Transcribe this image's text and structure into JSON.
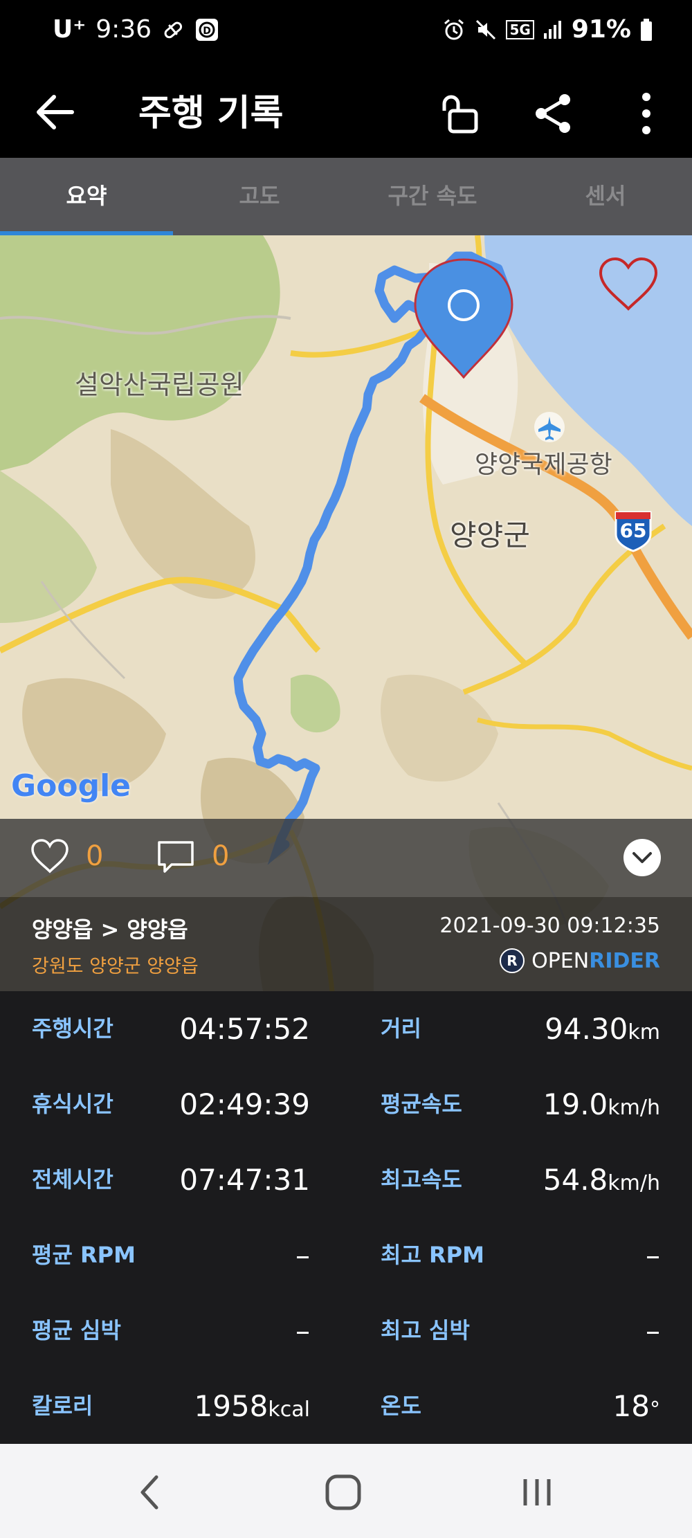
{
  "status_bar": {
    "carrier": "U⁺",
    "time": "9:36",
    "network": "5G",
    "battery": "91%"
  },
  "app_bar": {
    "title": "주행 기록"
  },
  "tabs": [
    {
      "label": "요약",
      "active": true
    },
    {
      "label": "고도",
      "active": false
    },
    {
      "label": "구간 속도",
      "active": false
    },
    {
      "label": "센서",
      "active": false
    }
  ],
  "map": {
    "labels": {
      "park": "설악산국립공원",
      "airport": "양양국제공항",
      "county": "양양군",
      "highway_number": "65",
      "google": "Google"
    },
    "favorite_icon": "heart-outline-icon",
    "route_color": "#4f8fe8"
  },
  "social": {
    "likes": "0",
    "comments": "0"
  },
  "route_info": {
    "title": "양양읍 > 양양읍",
    "location": "강원도 양양군 양양읍",
    "datetime": "2021-09-30 09:12:35",
    "brand_open": "OPEN",
    "brand_rider": "RIDER"
  },
  "stats": {
    "ride_time": {
      "label": "주행시간",
      "value": "04:57:52"
    },
    "distance": {
      "label": "거리",
      "value": "94.30",
      "unit": "km"
    },
    "rest_time": {
      "label": "휴식시간",
      "value": "02:49:39"
    },
    "avg_speed": {
      "label": "평균속도",
      "value": "19.0",
      "unit": "km/h"
    },
    "total_time": {
      "label": "전체시간",
      "value": "07:47:31"
    },
    "max_speed": {
      "label": "최고속도",
      "value": "54.8",
      "unit": "km/h"
    },
    "avg_rpm": {
      "label": "평균 RPM",
      "value": "–"
    },
    "max_rpm": {
      "label": "최고 RPM",
      "value": "–"
    },
    "avg_hr": {
      "label": "평균 심박",
      "value": "–"
    },
    "max_hr": {
      "label": "최고 심박",
      "value": "–"
    },
    "calories": {
      "label": "칼로리",
      "value": "1958",
      "unit": "kcal"
    },
    "temperature": {
      "label": "온도",
      "value": "18",
      "unit": "°"
    }
  },
  "colors": {
    "accent": "#2f86d8",
    "stat_label": "#8ac4ff",
    "orange": "#f0a040"
  }
}
